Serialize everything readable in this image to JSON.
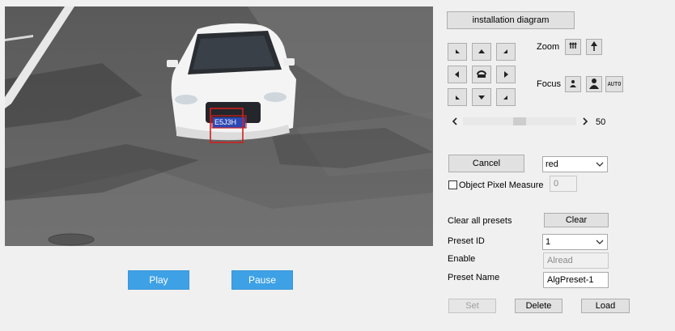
{
  "video": {
    "plate_text": "E5J3H",
    "play_label": "Play",
    "pause_label": "Pause"
  },
  "ptz": {
    "install_label": "installation diagram",
    "zoom_label": "Zoom",
    "focus_label": "Focus",
    "auto_label": "AUTO",
    "speed_value": "50",
    "speed_fraction": 0.5
  },
  "detect": {
    "cancel_label": "Cancel",
    "color_value": "red",
    "pixel_measure_label": "Object Pixel Measure",
    "pixel_measure_checked": false,
    "pixel_value": "0"
  },
  "preset": {
    "clear_all_label": "Clear all presets",
    "clear_label": "Clear",
    "id_label": "Preset ID",
    "id_value": "1",
    "enable_label": "Enable",
    "enable_value": "Alread",
    "name_label": "Preset Name",
    "name_value": "AlgPreset-1",
    "set_label": "Set",
    "delete_label": "Delete",
    "load_label": "Load"
  }
}
